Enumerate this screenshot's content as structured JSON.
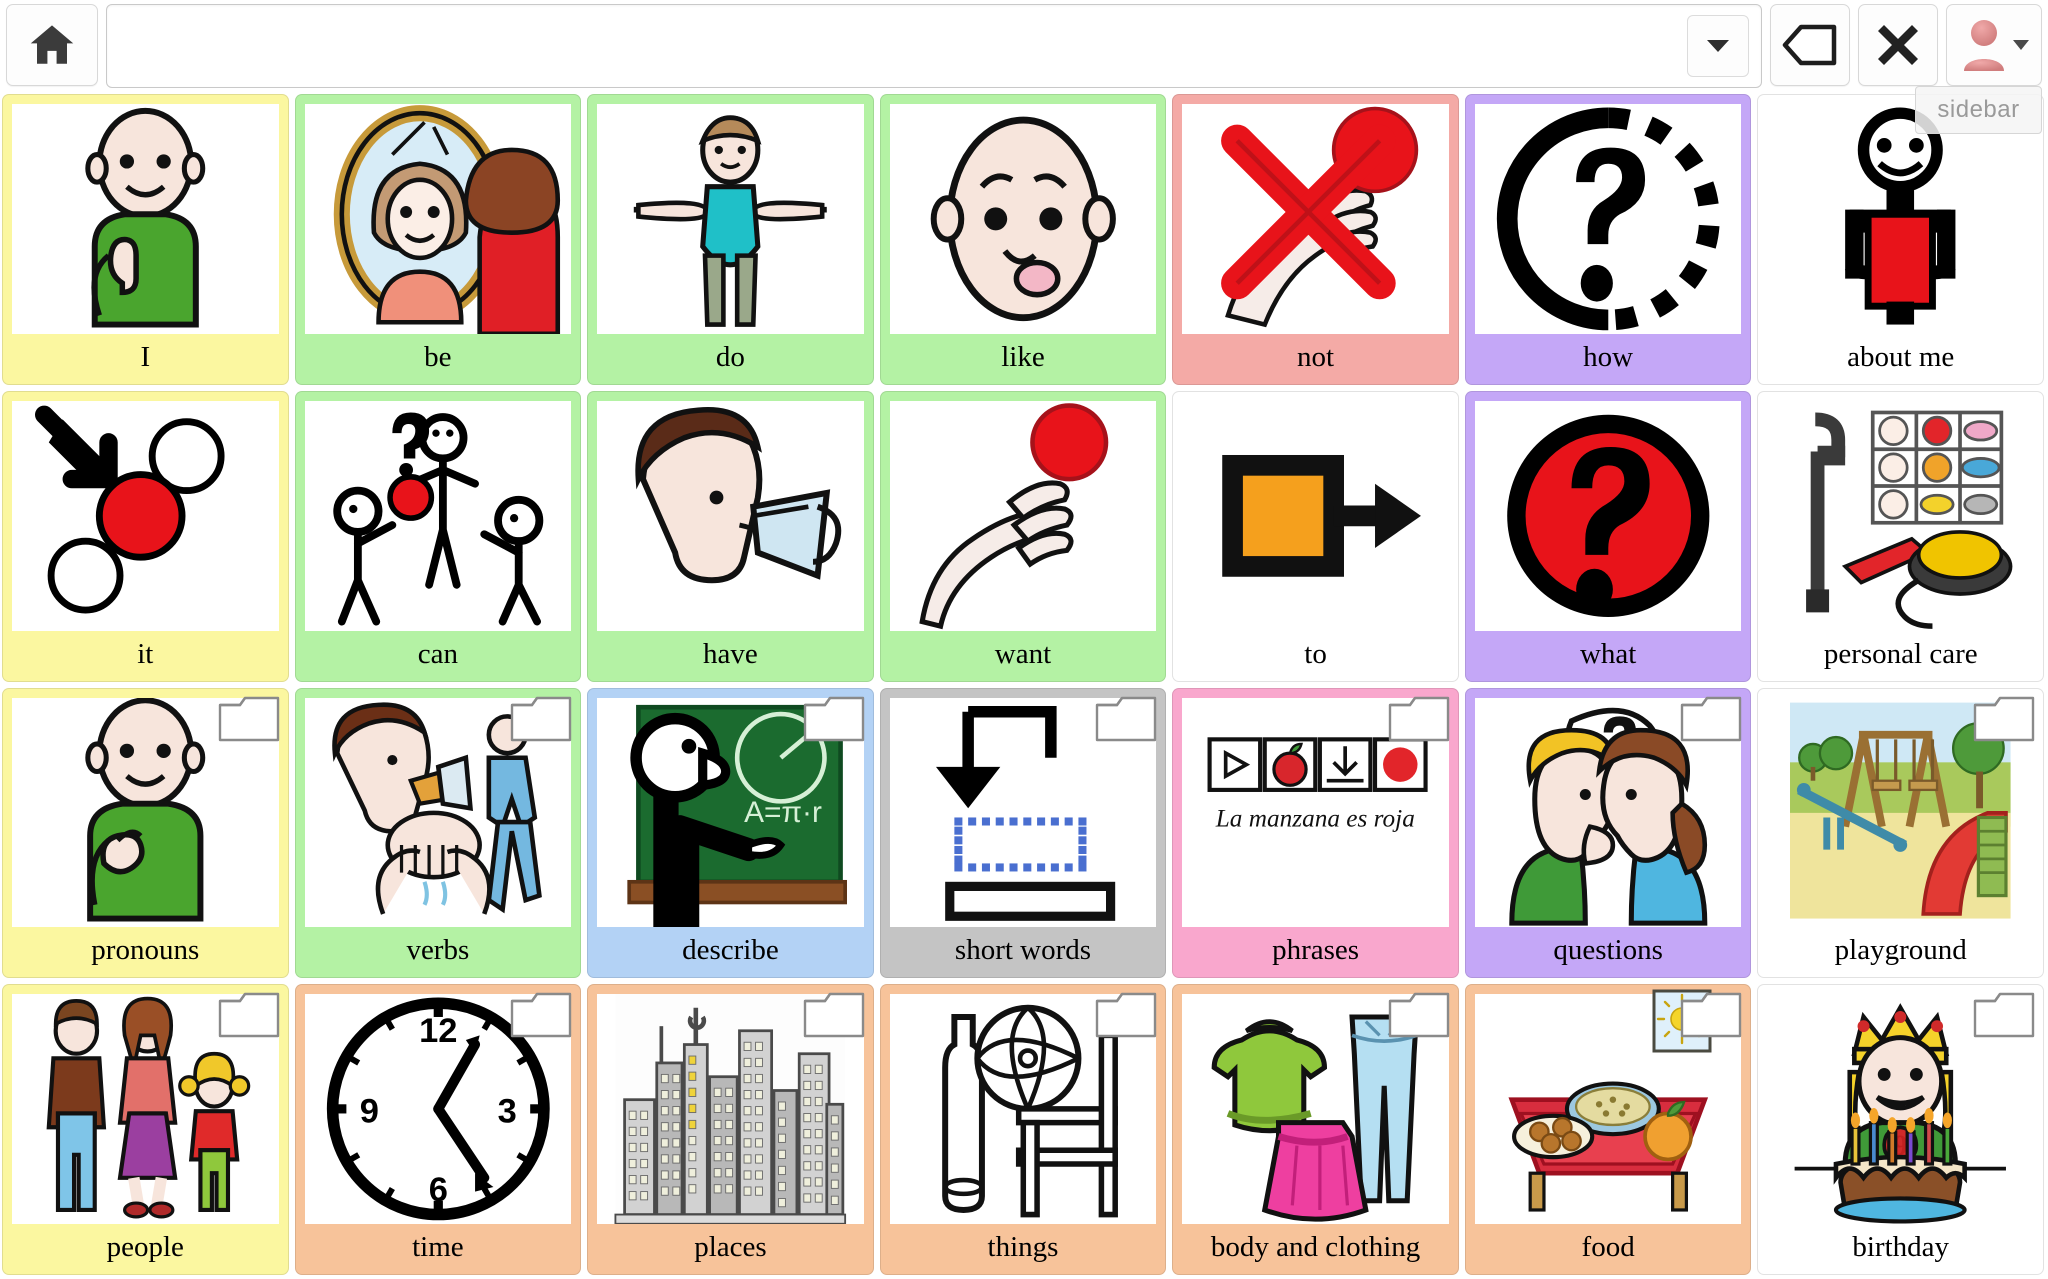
{
  "app": {
    "overlay_label": "sidebar"
  },
  "toolbar": {
    "home_label": "home",
    "message_value": "",
    "message_placeholder": "",
    "dropdown_label": "chevron-down",
    "backspace_label": "backspace",
    "clear_label": "clear",
    "user_label": "user"
  },
  "colors": {
    "yellow": "#fbf7a0",
    "green": "#b4f2a4",
    "red": "#f4aaa6",
    "purple": "#c4a7f7",
    "blue": "#b3d2f5",
    "gray": "#c4c4c4",
    "pink": "#f9a7cd",
    "orange": "#f7c39a",
    "white": "#ffffff"
  },
  "grid": {
    "columns": 7,
    "rows": 4,
    "cells": [
      {
        "label": "I",
        "color": "yellow",
        "icon": "person-pointing-self",
        "folder": false
      },
      {
        "label": "be",
        "color": "green",
        "icon": "mirror-reflection",
        "folder": false
      },
      {
        "label": "do",
        "color": "green",
        "icon": "gymnast-arms-out",
        "folder": false
      },
      {
        "label": "like",
        "color": "green",
        "icon": "face-tongue-out",
        "folder": false
      },
      {
        "label": "not",
        "color": "red",
        "icon": "hand-red-cross",
        "folder": false
      },
      {
        "label": "how",
        "color": "purple",
        "icon": "question-mark-dashed-circle",
        "folder": false
      },
      {
        "label": "about me",
        "color": "white",
        "icon": "stick-figure-red-book",
        "folder": false
      },
      {
        "label": "it",
        "color": "yellow",
        "icon": "arrow-to-red-circle",
        "folder": false
      },
      {
        "label": "can",
        "color": "green",
        "icon": "stick-figures-ball-question",
        "folder": false
      },
      {
        "label": "have",
        "color": "green",
        "icon": "person-drinking-cup",
        "folder": false
      },
      {
        "label": "want",
        "color": "green",
        "icon": "hand-reaching-red-ball",
        "folder": false
      },
      {
        "label": "to",
        "color": "white",
        "icon": "orange-square-arrow",
        "folder": false
      },
      {
        "label": "what",
        "color": "purple",
        "icon": "red-question-circle",
        "folder": false
      },
      {
        "label": "personal care",
        "color": "white",
        "icon": "crutch-board-switch",
        "folder": false
      },
      {
        "label": "pronouns",
        "color": "yellow",
        "icon": "person-pointing-forward",
        "folder": true
      },
      {
        "label": "verbs",
        "color": "green",
        "icon": "drink-wash-walk",
        "folder": true
      },
      {
        "label": "describe",
        "color": "blue",
        "icon": "teacher-chalkboard",
        "folder": true
      },
      {
        "label": "short words",
        "color": "gray",
        "icon": "arrow-into-blank",
        "folder": true
      },
      {
        "label": "phrases",
        "color": "pink",
        "icon": "symbol-sentence-strip",
        "folder": true
      },
      {
        "label": "questions",
        "color": "purple",
        "icon": "two-people-talking-question",
        "folder": true
      },
      {
        "label": "playground",
        "color": "white",
        "icon": "playground-scene",
        "folder": true
      },
      {
        "label": "people",
        "color": "yellow",
        "icon": "family-three",
        "folder": true
      },
      {
        "label": "time",
        "color": "orange",
        "icon": "analog-clock",
        "folder": true
      },
      {
        "label": "places",
        "color": "orange",
        "icon": "city-skyline",
        "folder": true
      },
      {
        "label": "things",
        "color": "orange",
        "icon": "bottle-ball-chair",
        "folder": true
      },
      {
        "label": "body and clothing",
        "color": "orange",
        "icon": "sweater-jeans-skirt",
        "folder": true
      },
      {
        "label": "food",
        "color": "orange",
        "icon": "table-with-meal",
        "folder": true,
        "photo": true
      },
      {
        "label": "birthday",
        "color": "white",
        "icon": "girl-crown-cake",
        "folder": true
      }
    ]
  },
  "phrases_card": {
    "caption": "La manzana es roja"
  },
  "describe_card": {
    "formula": "A=π·r"
  },
  "clock_card": {
    "numerals": [
      "12",
      "3",
      "6",
      "9"
    ]
  },
  "birthday_card": {
    "candle_number": "9"
  }
}
